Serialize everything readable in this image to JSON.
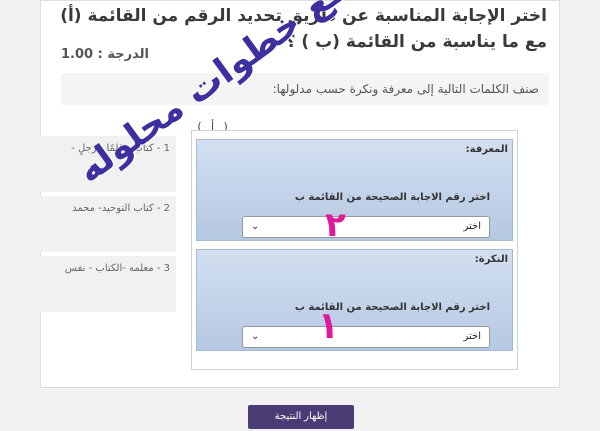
{
  "question": {
    "title": "اختر الإجابة المناسبة عن طريق تحديد الرقم من القائمة (أ) مع ما يناسبة من القائمة (ب ) ؟",
    "grade_label": "الدرجة :",
    "grade_value": "1.00",
    "prompt": "صنف الكلمات التالية إلى معرفة ونكرة حسب مدلولها:"
  },
  "list_a": {
    "header": "( أ )",
    "items": [
      "1 - كتابٌ - قلمًا - رجلٍ -",
      "2 - كتاب التوحيد- محمد",
      "3 - معلمه -الكتاب - نفس"
    ]
  },
  "categories": [
    {
      "label": "المعرفة:",
      "caption": "اختر رقم الاجابة الصحيحة من القائمة ب",
      "selected": "اختر"
    },
    {
      "label": "النكرة:",
      "caption": "اختر رقم الاجابة الصحيحة من القائمة ب",
      "selected": "اختر"
    }
  ],
  "buttons": {
    "show_result": "إظهار النتيجة"
  },
  "watermark": {
    "text": "موقع خطوات محلوله"
  },
  "annotations": [
    "٢",
    "١"
  ],
  "colors": {
    "button_bg": "#4a3b74",
    "panel_bg": "#c3d3ea",
    "watermark": "#3c2fa0",
    "annotation": "#e0189a"
  }
}
